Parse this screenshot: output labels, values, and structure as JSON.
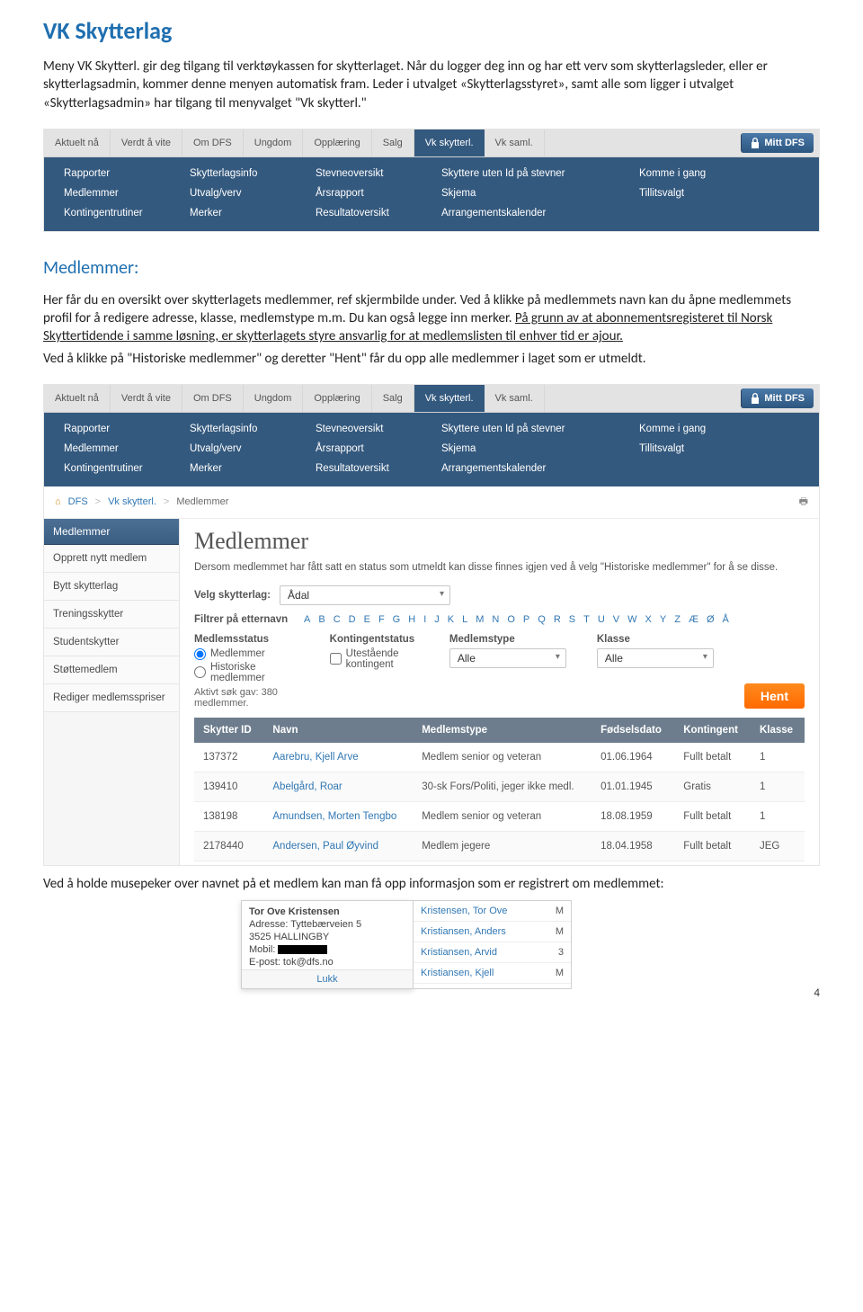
{
  "doc": {
    "h1": "VK Skytterlag",
    "intro": "Meny VK Skytterl. gir deg tilgang til verktøykassen for skytterlaget. Når du logger deg inn og har ett verv som skytterlagsleder, eller er skytterlagsadmin, kommer denne menyen automatisk fram. Leder i utvalget «Skytterlagsstyret», samt alle som ligger i utvalget «Skytterlagsadmin» har tilgang til menyvalget \"Vk skytterl.\"",
    "h2": "Medlemmer:",
    "body1": "Her får du en oversikt over skytterlagets medlemmer, ref skjermbilde under. Ved å klikke på medlemmets navn kan du åpne medlemmets profil for å redigere adresse, klasse, medlemstype m.m. Du kan også legge inn merker. ",
    "body_under": "På grunn av at abonnementsregisteret til Norsk Skyttertidende i samme løsning, er skytterlagets styre ansvarlig for at medlemslisten til enhver tid er ajour.",
    "body2": "Ved å klikke på \"Historiske medlemmer\" og deretter \"Hent\" får du opp alle medlemmer i laget som er utmeldt.",
    "footer_text": "Ved å holde musepeker over navnet på et medlem kan man få opp informasjon som er registrert om medlemmet:",
    "page_number": "4"
  },
  "topbar": {
    "tabs": [
      "Aktuelt nå",
      "Verdt å vite",
      "Om DFS",
      "Ungdom",
      "Opplæring",
      "Salg",
      "Vk skytterl.",
      "Vk saml."
    ],
    "active": "Vk skytterl.",
    "mitt": "Mitt DFS"
  },
  "submenu": {
    "c1": [
      "Rapporter",
      "Medlemmer",
      "Kontingentrutiner"
    ],
    "c2": [
      "Skytterlagsinfo",
      "Utvalg/verv",
      "Merker"
    ],
    "c3": [
      "Stevneoversikt",
      "Årsrapport",
      "Resultatoversikt"
    ],
    "c4": [
      "Skyttere uten Id på stevner",
      "Skjema",
      "Arrangementskalender"
    ],
    "c5": [
      "Komme i gang",
      "Tillitsvalgt",
      ""
    ]
  },
  "crumb": {
    "home": "DFS",
    "mid": "Vk skytterl.",
    "leaf": "Medlemmer"
  },
  "sidemenu": {
    "head": "Medlemmer",
    "items": [
      "Opprett nytt medlem",
      "Bytt skytterlag",
      "Treningsskytter",
      "Studentskytter",
      "Støttemedlem",
      "Rediger medlemsspriser"
    ]
  },
  "main": {
    "title": "Medlemmer",
    "blurb": "Dersom medlemmet har fått satt en status som utmeldt kan disse finnes igjen ved å velg \"Historiske medlemmer\" for å se disse.",
    "velg_label": "Velg skytterlag:",
    "velg_value": "Ådal",
    "filtrer_label": "Filtrer på etternavn",
    "filter_heads": {
      "status": "Medlemsstatus",
      "kont": "Kontingentstatus",
      "type": "Medlemstype",
      "klasse": "Klasse"
    },
    "radio1": "Medlemmer",
    "radio2": "Historiske medlemmer",
    "checkbox1": "Utestående kontingent",
    "dd_alle": "Alle",
    "hent": "Hent",
    "aktiv": "Aktivt søk gav: 380 medlemmer."
  },
  "alphabet": [
    "A",
    "B",
    "C",
    "D",
    "E",
    "F",
    "G",
    "H",
    "I",
    "J",
    "K",
    "L",
    "M",
    "N",
    "O",
    "P",
    "Q",
    "R",
    "S",
    "T",
    "U",
    "V",
    "W",
    "X",
    "Y",
    "Z",
    "Æ",
    "Ø",
    "Å"
  ],
  "table": {
    "headers": [
      "Skytter ID",
      "Navn",
      "Medlemstype",
      "Fødselsdato",
      "Kontingent",
      "Klasse"
    ],
    "rows": [
      {
        "id": "137372",
        "navn": "Aarebru, Kjell Arve",
        "type": "Medlem senior og veteran",
        "dob": "01.06.1964",
        "kont": "Fullt betalt",
        "kl": "1"
      },
      {
        "id": "139410",
        "navn": "Abelgård, Roar",
        "type": "30-sk Fors/Politi, jeger ikke medl.",
        "dob": "01.01.1945",
        "kont": "Gratis",
        "kl": "1"
      },
      {
        "id": "138198",
        "navn": "Amundsen, Morten Tengbo",
        "type": "Medlem senior og veteran",
        "dob": "18.08.1959",
        "kont": "Fullt betalt",
        "kl": "1"
      },
      {
        "id": "2178440",
        "navn": "Andersen, Paul Øyvind",
        "type": "Medlem jegere",
        "dob": "18.04.1958",
        "kont": "Fullt betalt",
        "kl": "JEG"
      }
    ]
  },
  "tooltip": {
    "name": "Tor Ove Kristensen",
    "addr1": "Adresse: Tyttebærveien 5",
    "addr2": "3525 HALLINGBY",
    "mobil_label": "Mobil:",
    "epost": "E-post: tok@dfs.no",
    "lukk": "Lukk",
    "list": [
      {
        "n": "Kristensen, Tor Ove",
        "v": "M"
      },
      {
        "n": "Kristiansen, Anders",
        "v": "M"
      },
      {
        "n": "Kristiansen, Arvid",
        "v": "3"
      },
      {
        "n": "Kristiansen, Kjell",
        "v": "M"
      }
    ]
  }
}
